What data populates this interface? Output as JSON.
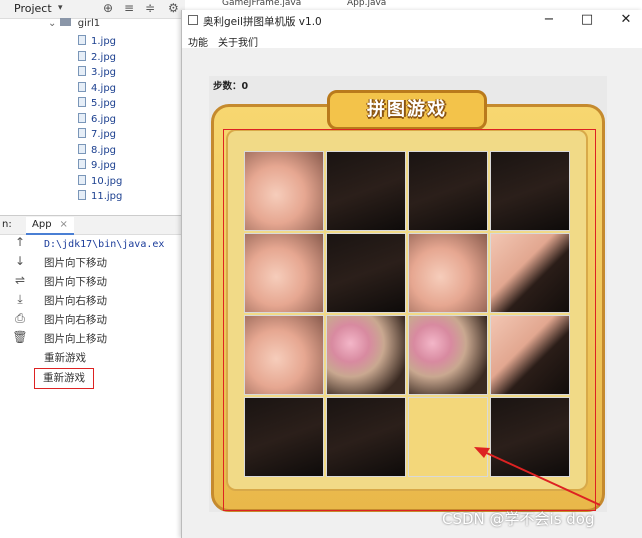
{
  "ide": {
    "project_title": "Project",
    "folder": "girl1",
    "files": [
      "1.jpg",
      "2.jpg",
      "3.jpg",
      "4.jpg",
      "5.jpg",
      "6.jpg",
      "7.jpg",
      "8.jpg",
      "9.jpg",
      "10.jpg",
      "11.jpg"
    ],
    "run_label": "n:",
    "run_tab": "App",
    "console_lines": [
      "D:\\jdk17\\bin\\java.ex",
      "图片向下移动",
      "图片向下移动",
      "图片向右移动",
      "图片向右移动",
      "图片向上移动",
      "重新游戏",
      "重新游戏"
    ]
  },
  "editor_tabs": [
    "GameJFrame.java",
    "App.java"
  ],
  "window": {
    "title": "奥利geil拼图单机版 v1.0",
    "menu": [
      "功能",
      "关于我们"
    ],
    "steps_label": "步数：0",
    "banner": "拼图游戏",
    "tiles": [
      "skin",
      "hair",
      "hair",
      "hair",
      "skin",
      "hair",
      "skin",
      "hairskin",
      "skin",
      "flower",
      "flower",
      "hairskin",
      "hair",
      "hair",
      "blank",
      "hair"
    ]
  },
  "watermark": "CSDN @学不会is dog",
  "colors": {
    "annotation_red": "#d22222"
  }
}
